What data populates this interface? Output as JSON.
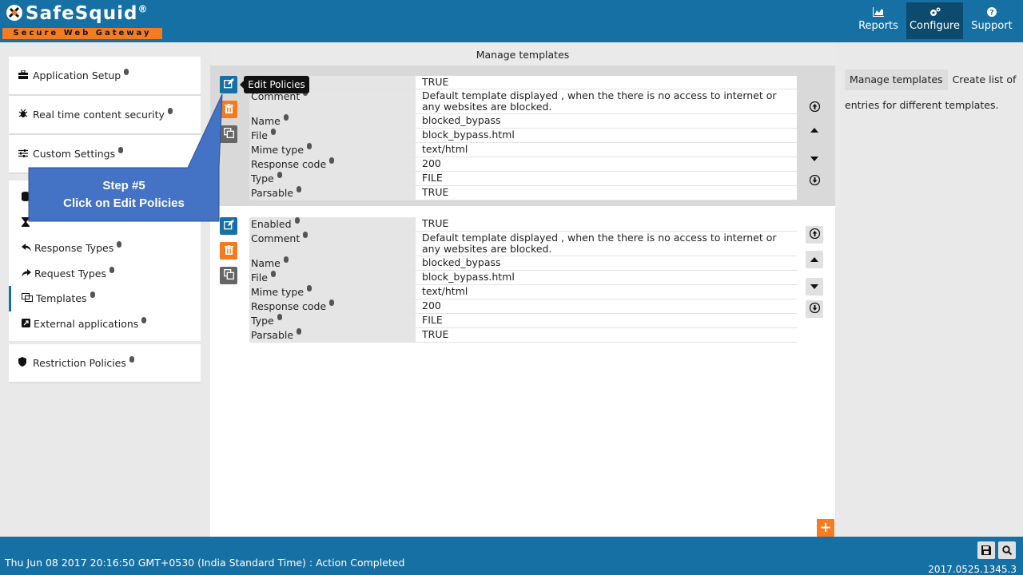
{
  "header": {
    "brand": "SafeSquid",
    "registered": "®",
    "tagline": "Secure Web Gateway",
    "nav": [
      {
        "label": "Reports",
        "icon": "chart-icon"
      },
      {
        "label": "Configure",
        "icon": "gears-icon",
        "active": true
      },
      {
        "label": "Support",
        "icon": "question-icon"
      }
    ]
  },
  "sidebar": {
    "top_items": [
      {
        "label": "Application Setup",
        "icon": "briefcase-icon"
      },
      {
        "label": "Real time content security",
        "icon": "bug-icon"
      },
      {
        "label": "Custom Settings",
        "icon": "sliders-icon"
      }
    ],
    "sub_items": [
      {
        "label": "",
        "icon": "database-icon"
      },
      {
        "label": "",
        "icon": "hourglass-icon"
      },
      {
        "label": "Response Types",
        "icon": "reply-icon"
      },
      {
        "label": "Request Types",
        "icon": "share-icon"
      },
      {
        "label": "Templates",
        "icon": "templates-icon",
        "active": true
      },
      {
        "label": "External applications",
        "icon": "external-icon"
      }
    ],
    "bottom_items": [
      {
        "label": "Restriction Policies",
        "icon": "shield-icon"
      }
    ]
  },
  "main": {
    "title": "Manage templates",
    "add_label": "+",
    "policies": [
      {
        "fields": [
          {
            "key": "",
            "value": "TRUE"
          },
          {
            "key": "Comment",
            "value": "Default template displayed , when the there is no access to internet or any websites are blocked."
          },
          {
            "key": "Name",
            "value": "blocked_bypass"
          },
          {
            "key": "File",
            "value": "block_bypass.html"
          },
          {
            "key": "Mime type",
            "value": "text/html"
          },
          {
            "key": "Response code",
            "value": "200"
          },
          {
            "key": "Type",
            "value": "FILE"
          },
          {
            "key": "Parsable",
            "value": "TRUE"
          }
        ]
      },
      {
        "fields": [
          {
            "key": "Enabled",
            "value": "TRUE"
          },
          {
            "key": "Comment",
            "value": "Default template displayed , when the there is no access to internet or any websites are blocked."
          },
          {
            "key": "Name",
            "value": "blocked_bypass"
          },
          {
            "key": "File",
            "value": "block_bypass.html"
          },
          {
            "key": "Mime type",
            "value": "text/html"
          },
          {
            "key": "Response code",
            "value": "200"
          },
          {
            "key": "Type",
            "value": "FILE"
          },
          {
            "key": "Parsable",
            "value": "TRUE"
          }
        ]
      }
    ]
  },
  "tooltip": {
    "text": "Edit Policies"
  },
  "callout": {
    "line1": "Step #5",
    "line2": "Click on  Edit Policies",
    "color": "#4472c4"
  },
  "help": {
    "tag": "Manage templates",
    "text": "Create list of entries for different templates."
  },
  "footer": {
    "status": "Thu Jun 08 2017 20:16:50 GMT+0530 (India Standard Time) : Action Completed",
    "version": "2017.0525.1345.3"
  },
  "colors": {
    "primary": "#1670a3",
    "accent": "#f47b20",
    "dark_nav": "#0c4a6e"
  }
}
